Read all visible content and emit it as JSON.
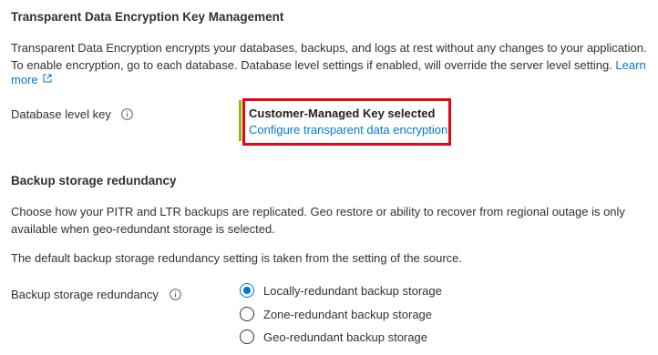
{
  "tde": {
    "heading": "Transparent Data Encryption Key Management",
    "desc_line1": "Transparent Data Encryption encrypts your databases, backups, and logs at rest without any changes to your application.",
    "desc_line2": "To enable encryption, go to each database. Database level settings if enabled, will override the server level setting.",
    "learn": "Learn",
    "more": "more",
    "db_level_label": "Database level key",
    "card_title": "Customer-Managed Key selected",
    "card_link": "Configure transparent data encryption"
  },
  "backup": {
    "heading": "Backup storage redundancy",
    "desc_line1": "Choose how your PITR and LTR backups are replicated. Geo restore or ability to recover from regional outage is only",
    "desc_line2": "available when geo-redundant storage is selected.",
    "default_note": "The default backup storage redundancy setting is taken from the setting of the source.",
    "field_label": "Backup storage redundancy",
    "options": [
      {
        "label": "Locally-redundant backup storage",
        "selected": true
      },
      {
        "label": "Zone-redundant backup storage",
        "selected": false
      },
      {
        "label": "Geo-redundant backup storage",
        "selected": false
      }
    ]
  },
  "colors": {
    "link": "#0078d4",
    "highlight": "#e30613",
    "card_accent": "#8cbd18"
  },
  "icons": {
    "info": "info-icon",
    "external": "external-link-icon"
  }
}
